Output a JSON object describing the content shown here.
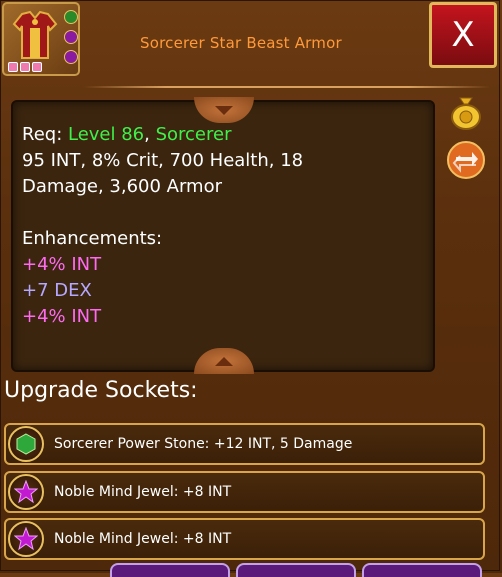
{
  "header": {
    "item_name": "Sorcerer Star Beast Armor",
    "close_label": "X"
  },
  "description": {
    "req_label": "Req: ",
    "level": "Level 86",
    "sep": ", ",
    "class": "Sorcerer",
    "stats_line1": "95 INT, 8% Crit, 700 Health, 18",
    "stats_line2": "Damage, 3,600 Armor",
    "enhancements_label": "Enhancements:",
    "enhancements": [
      "+4% INT",
      "+7 DEX",
      "+4% INT"
    ]
  },
  "sockets": {
    "heading": "Upgrade Sockets:",
    "items": [
      {
        "label": "Sorcerer Power Stone: +12 INT, 5 Damage",
        "gem": "green-gem-icon"
      },
      {
        "label": "Noble Mind Jewel: +8 INT",
        "gem": "purple-star-icon"
      },
      {
        "label": "Noble Mind Jewel: +8 INT",
        "gem": "purple-star-icon"
      }
    ]
  },
  "colors": {
    "title": "#ff9a3a",
    "level": "#3ff04a",
    "int_enh": "#ff6af0",
    "dex_enh": "#b6a8ff"
  }
}
